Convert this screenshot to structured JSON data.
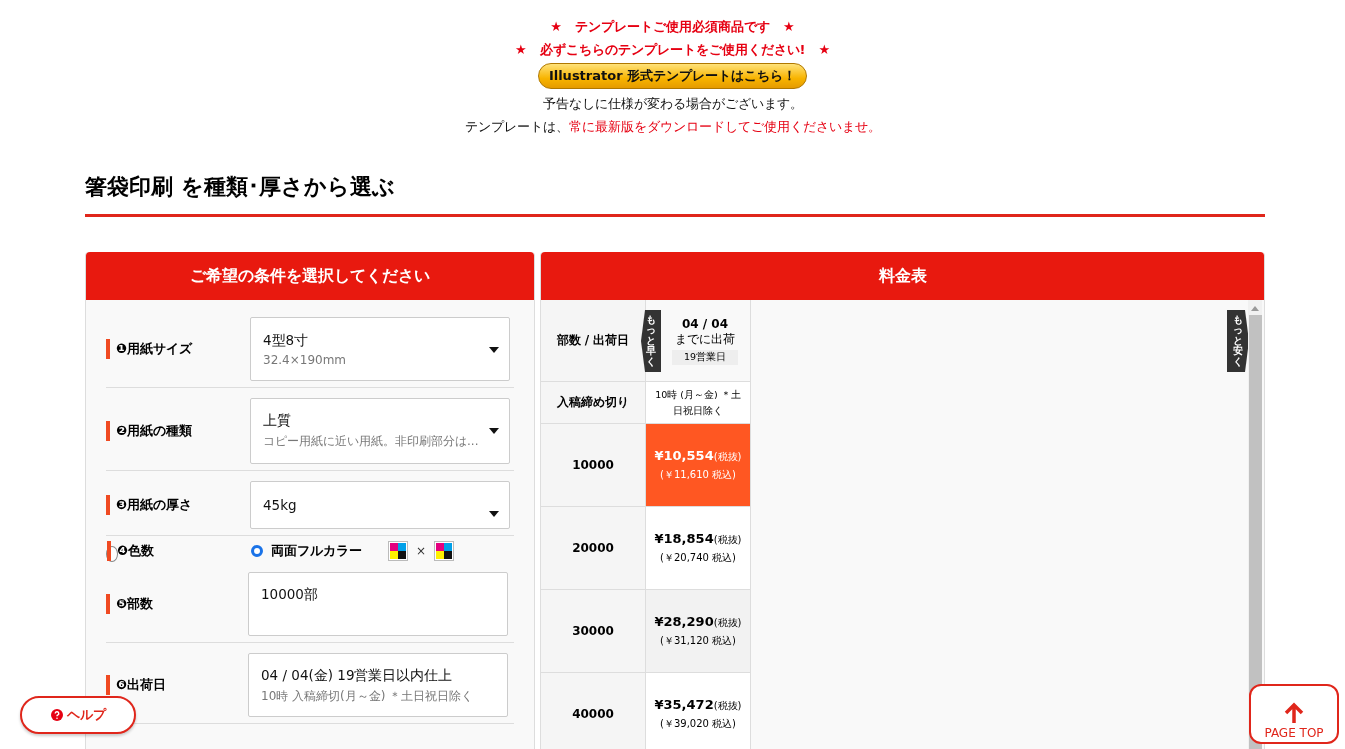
{
  "notice": {
    "lines": [
      "★　テンプレートご使用必須商品です　★",
      "★　必ずこちらのテンプレートをご使用ください!　★"
    ],
    "template_button": "Illustrator 形式テンプレートはこちら！",
    "note": "予告なしに仕様が変わる場合がございます。",
    "note2": {
      "prefix": "テンプレートは、",
      "highlight": "常に最新版をダウンロードしてご使用くださいませ。"
    }
  },
  "heading": "箸袋印刷 を種類･厚さから選ぶ",
  "form": {
    "title": "ご希望の条件を選択してください",
    "rows": [
      {
        "kind": "select",
        "label": "❶用紙サイズ",
        "value": "4型8寸",
        "sub": "32.4×190mm"
      },
      {
        "kind": "select",
        "label": "❷用紙の種類",
        "value": "上質",
        "sub": "コピー用紙に近い用紙。非印刷部分は..."
      },
      {
        "kind": "select",
        "label": "❸用紙の厚さ",
        "value": "45kg"
      },
      {
        "kind": "radio",
        "label": "❹色数",
        "option": "両面フルカラー",
        "selected": true,
        "times": "×"
      },
      {
        "kind": "input",
        "label": "❺部数",
        "value": "10000部"
      },
      {
        "kind": "input",
        "label": "❻出荷日",
        "value": "04 / 04(金) 19営業日以内仕上",
        "sub": "10時 入稿締切(月～金) ＊土日祝日除く"
      }
    ]
  },
  "price_table": {
    "title": "料金表",
    "header_label": "部数 / 出荷日",
    "earlier": "もっと早く",
    "cheaper": "もっと安く",
    "date": "04 / 04",
    "date_note": "までに出荷",
    "days": "19営業日",
    "deadline_label": "入稿締め切り",
    "deadline": "10時 (月～金) ＊土日祝日除く",
    "rows": [
      {
        "qty": "10000",
        "price": "¥10,554",
        "price_note": "(税抜)",
        "tax": "(￥11,610 税込)",
        "selected": true,
        "shaded": false
      },
      {
        "qty": "20000",
        "price": "¥18,854",
        "price_note": "(税抜)",
        "tax": "(￥20,740 税込)",
        "selected": false,
        "shaded": false
      },
      {
        "qty": "30000",
        "price": "¥28,290",
        "price_note": "(税抜)",
        "tax": "(￥31,120 税込)",
        "selected": false,
        "shaded": true
      },
      {
        "qty": "40000",
        "price": "¥35,472",
        "price_note": "(税抜)",
        "tax": "(￥39,020 税込)",
        "selected": false,
        "shaded": false
      }
    ]
  },
  "help_button": "ヘルプ",
  "page_top": "PAGE TOP"
}
